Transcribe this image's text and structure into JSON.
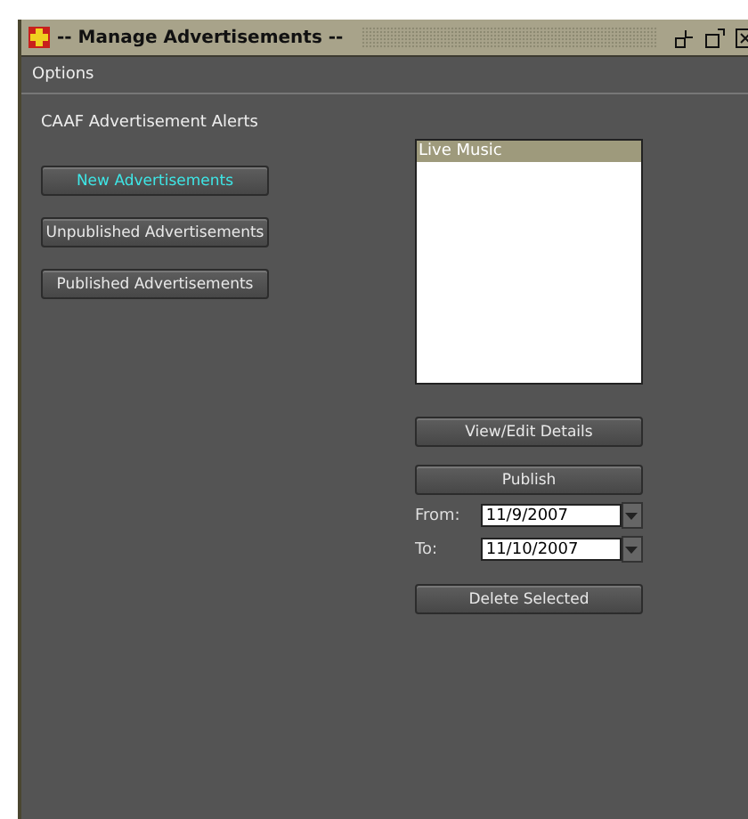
{
  "window": {
    "title": "-- Manage Advertisements --"
  },
  "menu": [
    "Options"
  ],
  "heading": "CAAF Advertisement Alerts",
  "nav_buttons": [
    {
      "label": "New Advertisements",
      "selected": true
    },
    {
      "label": "Unpublished Advertisements",
      "selected": false
    },
    {
      "label": "Published Advertisements",
      "selected": false
    }
  ],
  "list": {
    "items": [
      {
        "label": "Live Music",
        "selected": true
      }
    ]
  },
  "view_button": "View/Edit Details",
  "publish_button": "Publish",
  "dates": [
    {
      "label": "From:",
      "value": "11/9/2007"
    },
    {
      "label": "To:",
      "value": "11/10/2007"
    }
  ],
  "delete_button": "Delete Selected"
}
